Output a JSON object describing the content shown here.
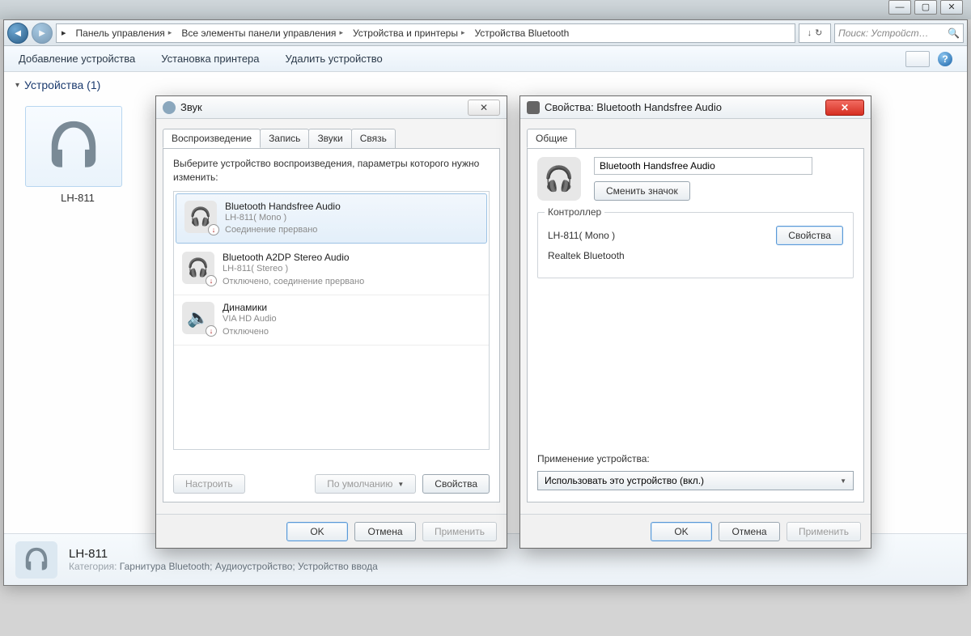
{
  "window_controls": {
    "minimize": "—",
    "maximize": "▢",
    "close": "✕"
  },
  "breadcrumb": {
    "items": [
      "Панель управления",
      "Все элементы панели управления",
      "Устройства и принтеры",
      "Устройства Bluetooth"
    ]
  },
  "address_refresh_glyphs": {
    "r1": "↻",
    "r2": "↓"
  },
  "search": {
    "placeholder": "Поиск: Устройст…",
    "glyph": "🔍"
  },
  "command_bar": {
    "add_device": "Добавление устройства",
    "add_printer": "Установка принтера",
    "remove_device": "Удалить устройство",
    "help_glyph": "?"
  },
  "section_header": "Устройства (1)",
  "device_tile": {
    "label": "LH-811"
  },
  "sound_dialog": {
    "title": "Звук",
    "close_glyph": "✕",
    "tabs": {
      "playback": "Воспроизведение",
      "record": "Запись",
      "sounds": "Звуки",
      "comm": "Связь"
    },
    "hint": "Выберите устройство воспроизведения, параметры которого нужно изменить:",
    "devices": [
      {
        "name": "Bluetooth Handsfree Audio",
        "sub1": "LH-811( Mono )",
        "sub2": "Соединение прервано"
      },
      {
        "name": "Bluetooth A2DP Stereo Audio",
        "sub1": "LH-811( Stereo )",
        "sub2": "Отключено, соединение прервано"
      },
      {
        "name": "Динамики",
        "sub1": "VIA HD Audio",
        "sub2": "Отключено"
      }
    ],
    "buttons": {
      "configure": "Настроить",
      "set_default": "По умолчанию",
      "properties": "Свойства"
    },
    "footer": {
      "ok": "OK",
      "cancel": "Отмена",
      "apply": "Применить"
    }
  },
  "props_dialog": {
    "title": "Свойства: Bluetooth Handsfree Audio",
    "close_glyph": "✕",
    "tab_general": "Общие",
    "device_name": "Bluetooth Handsfree Audio",
    "change_icon": "Сменить значок",
    "controller_legend": "Контроллер",
    "controller_line1": "LH-811( Mono )",
    "controller_line2": "Realtek Bluetooth",
    "controller_btn": "Свойства",
    "usage_label": "Применение устройства:",
    "usage_value": "Использовать это устройство (вкл.)",
    "footer": {
      "ok": "OK",
      "cancel": "Отмена",
      "apply": "Применить"
    }
  },
  "details_pane": {
    "title": "LH-811",
    "category_label": "Категория:",
    "category_value": "Гарнитура Bluetooth; Аудиоустройство; Устройство ввода"
  }
}
